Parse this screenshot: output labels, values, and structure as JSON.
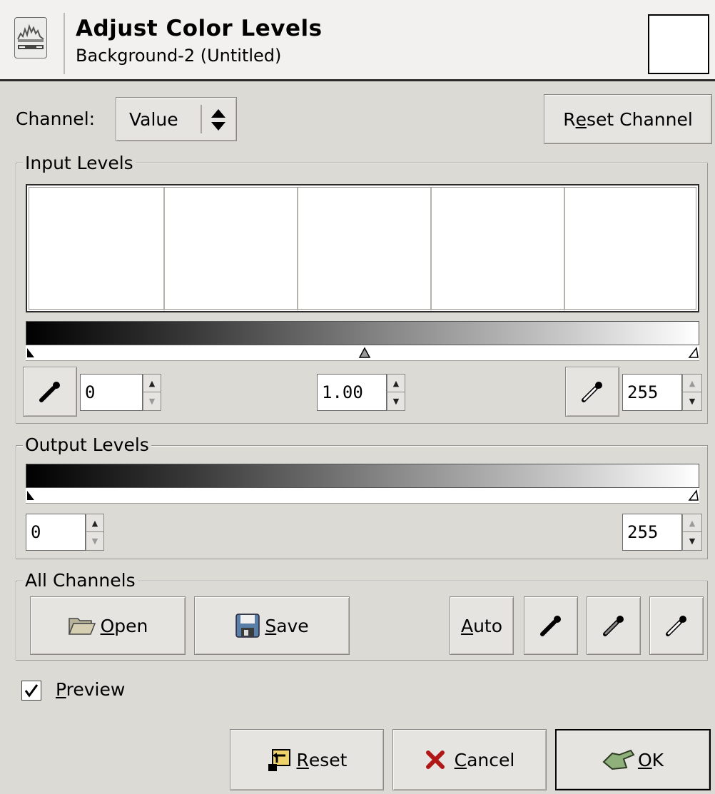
{
  "header": {
    "title": "Adjust Color Levels",
    "subtitle": "Background-2 (Untitled)"
  },
  "channel": {
    "label": "Channel:",
    "value": "Value",
    "reset_label_pre": "R",
    "reset_label_u": "e",
    "reset_label_post": "set Channel"
  },
  "input_levels": {
    "title": "Input Levels",
    "low": "0",
    "gamma": "1.00",
    "high": "255"
  },
  "output_levels": {
    "title": "Output Levels",
    "low": "0",
    "high": "255"
  },
  "all_channels": {
    "title": "All Channels",
    "open_u": "O",
    "open_rest": "pen",
    "save_u": "S",
    "save_rest": "ave",
    "auto_u": "A",
    "auto_rest": "uto"
  },
  "preview": {
    "checked": true,
    "label_u": "P",
    "label_rest": "review"
  },
  "footer": {
    "reset_u": "R",
    "reset_rest": "eset",
    "cancel_u": "C",
    "cancel_rest": "ancel",
    "ok_u": "O",
    "ok_rest": "K"
  }
}
